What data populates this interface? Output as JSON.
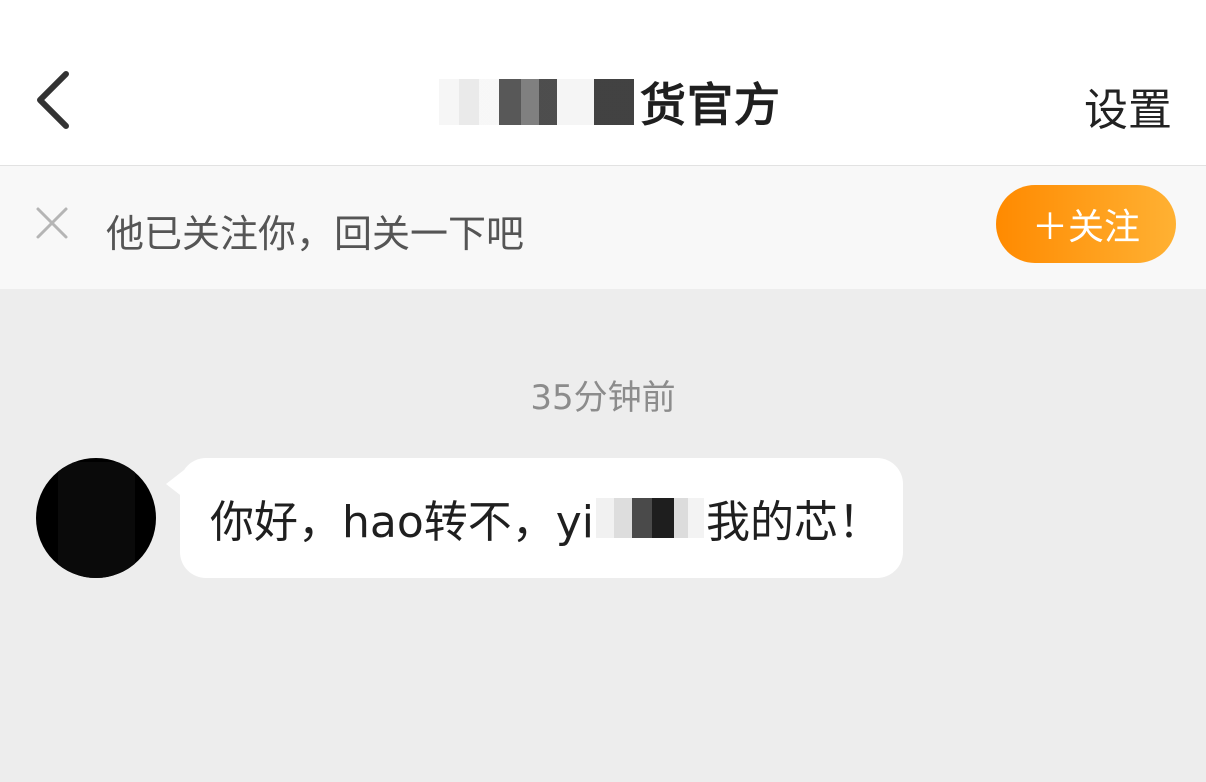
{
  "header": {
    "title_visible": "货官方",
    "settings_label": "设置"
  },
  "follow_bar": {
    "message": "他已关注你，回关一下吧",
    "follow_button_label": "＋关注"
  },
  "chat": {
    "timestamp": "35分钟前",
    "messages": [
      {
        "from": "other",
        "text_before_redaction": "你好，hao转不，yi",
        "text_after_redaction": "我的芯！"
      }
    ]
  },
  "colors": {
    "accent_orange": "#ff9a1a",
    "chat_background": "#ededed",
    "header_background": "#ffffff"
  },
  "icons": {
    "back": "chevron-left-icon",
    "close": "close-icon"
  }
}
